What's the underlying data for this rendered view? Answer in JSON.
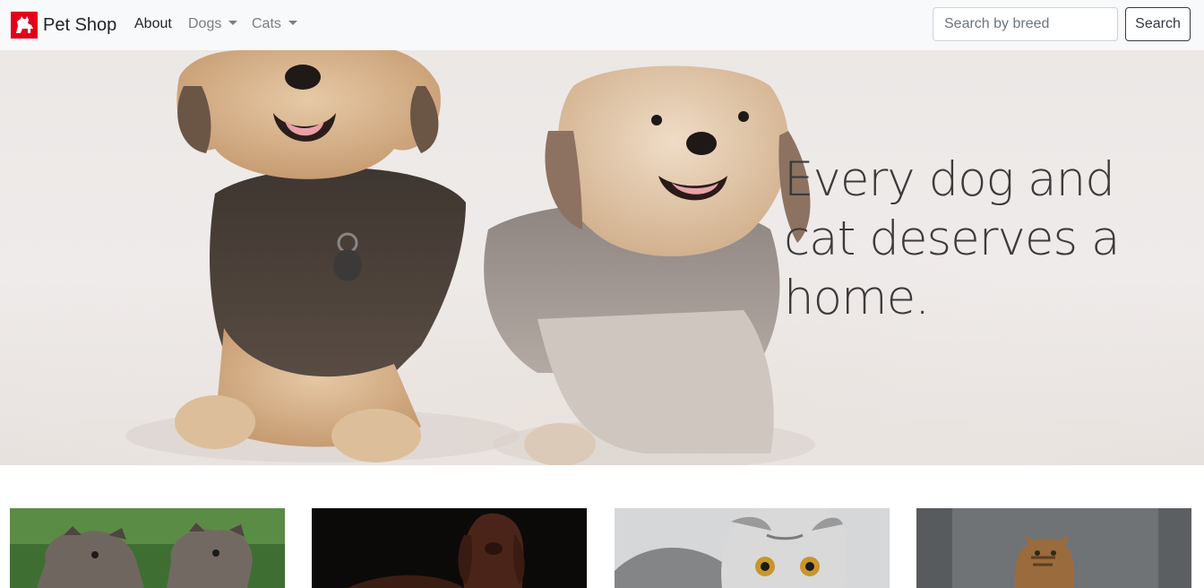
{
  "navbar": {
    "brand": {
      "name": "Pet Shop",
      "logo_icon": "dog-logo-icon",
      "logo_color": "#e2001a"
    },
    "links": [
      {
        "label": "About",
        "dropdown": false
      },
      {
        "label": "Dogs",
        "dropdown": true
      },
      {
        "label": "Cats",
        "dropdown": true
      }
    ],
    "search": {
      "placeholder": "Search by breed",
      "value": "",
      "button_label": "Search"
    }
  },
  "hero": {
    "headline": "Every dog and cat deserves a home.",
    "image": "two-small-dogs-photo"
  },
  "cards": [
    {
      "image": "schnauzer-dogs-on-grass-photo"
    },
    {
      "image": "brown-dog-dark-background-photo"
    },
    {
      "image": "scottish-fold-cat-photo"
    },
    {
      "image": "tabby-cat-photo"
    }
  ]
}
